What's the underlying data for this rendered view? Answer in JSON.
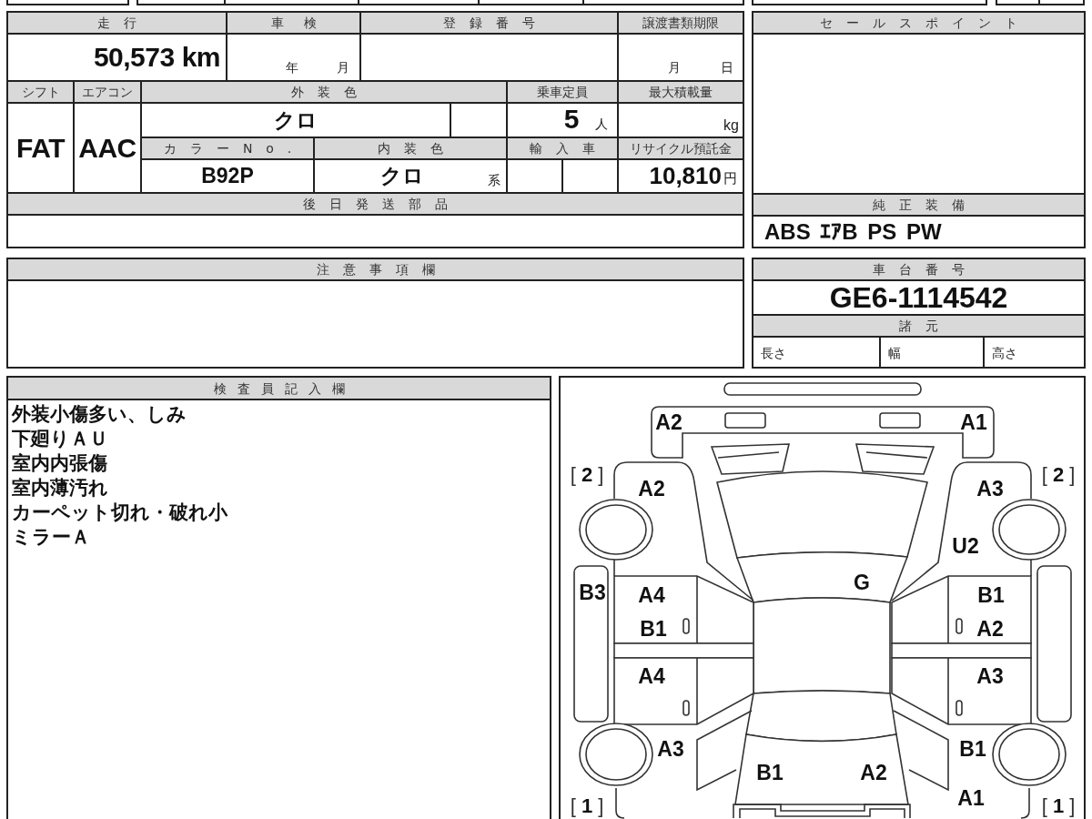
{
  "top_table": {
    "mileage": {
      "label": "走行",
      "value": "50,573",
      "unit": "km"
    },
    "inspection": {
      "label": "車検",
      "year": "年",
      "month": "月"
    },
    "registration_number": {
      "label": "登録番号"
    },
    "document_deadline": {
      "label": "譲渡書類期限",
      "month": "月",
      "day": "日"
    },
    "shift": {
      "label": "シフト",
      "value": "FAT"
    },
    "air_conditioner": {
      "label": "エアコン",
      "value": "AAC"
    },
    "exterior_color": {
      "label": "外装色",
      "value": "クロ"
    },
    "capacity": {
      "label": "乗車定員",
      "value": "5",
      "unit": "人"
    },
    "max_load": {
      "label": "最大積載量",
      "unit": "kg"
    },
    "color_number": {
      "label": "カラーNo.",
      "value": "B92P"
    },
    "interior_color": {
      "label": "内装色",
      "value": "クロ",
      "suffix": "系"
    },
    "imported": {
      "label": "輸入車"
    },
    "recycling_fee": {
      "label": "リサイクル預託金",
      "value": "10,810",
      "unit": "円"
    },
    "parts_sent_later": {
      "label": "後日発送部品"
    }
  },
  "sales_points": {
    "label": "セールスポイント"
  },
  "standard_equipment": {
    "label": "純正装備",
    "value": "ABS ｴｱB PS PW"
  },
  "caution_notes": {
    "label": "注意事項欄"
  },
  "chassis_number": {
    "label": "車台番号",
    "value": "GE6-1114542"
  },
  "specifications": {
    "label": "諸元",
    "items": [
      "長さ",
      "幅",
      "高さ"
    ]
  },
  "inspector_notes": {
    "label": "検査員記入欄",
    "lines": [
      "外装小傷多い、しみ",
      "下廻りＡＵ",
      "室内内張傷",
      "室内薄汚れ",
      "カーペット切れ・破れ小",
      "ミラーＡ"
    ]
  },
  "damage_diagram": {
    "position_labels": [
      "[ **2** ]",
      "[ **2** ]",
      "[ **1** ]",
      "[ **1** ]"
    ],
    "codes": [
      "A2",
      "A1",
      "A2",
      "A3",
      "U2",
      "G",
      "B3",
      "A4",
      "B1",
      "B1",
      "A2",
      "A4",
      "A3",
      "A3",
      "B1",
      "B1",
      "A2",
      "A1"
    ]
  }
}
